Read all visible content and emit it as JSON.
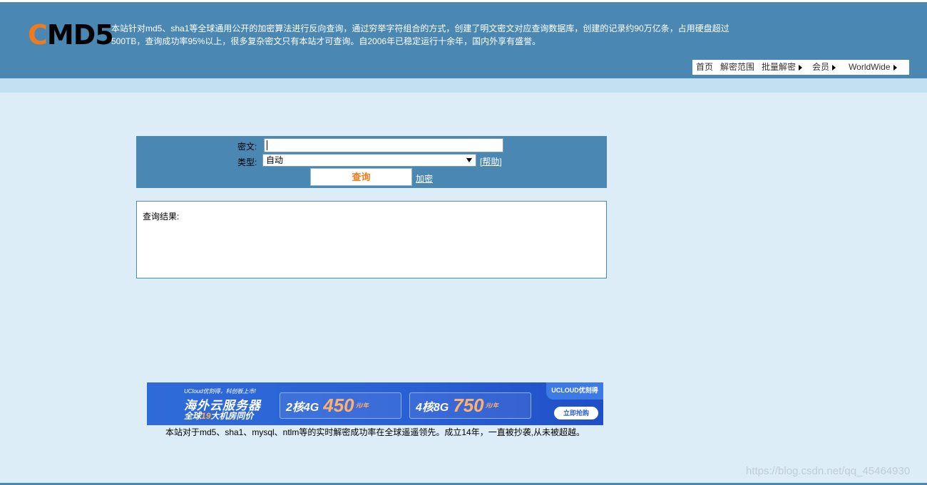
{
  "header": {
    "logo_first": "C",
    "logo_rest": "MD5",
    "intro": "本站针对md5、sha1等全球通用公开的加密算法进行反向查询，通过穷举字符组合的方式，创建了明文密文对应查询数据库，创建的记录约90万亿条，占用硬盘超过500TB，查询成功率95%以上，很多复杂密文只有本站才可查询。自2006年已稳定运行十余年，国内外享有盛誉。"
  },
  "nav": {
    "items": [
      {
        "label": "首页"
      },
      {
        "label": "解密范围"
      },
      {
        "label": "批量解密"
      },
      {
        "label": "会员"
      },
      {
        "label": "WorldWide"
      }
    ]
  },
  "query": {
    "cipher_label": "密文:",
    "cipher_value": "",
    "type_label": "类型:",
    "type_selected": "自动",
    "help_link": "[帮助]",
    "query_button": "查询",
    "encrypt_link": "加密"
  },
  "result": {
    "label": "查询结果:"
  },
  "ad": {
    "small_text": "UCloud优刻得，科创板上市!",
    "title": "海外云服务器",
    "sub_prefix": "全球",
    "sub_highlight": "19",
    "sub_suffix": "大机房同价",
    "card1_spec": "2核4G",
    "card1_price": "450",
    "card1_unit": "元/年",
    "card2_spec": "4核8G",
    "card2_price": "750",
    "card2_unit": "元/年",
    "brand": "UCLOUD优刻得",
    "cta": "立即抢购"
  },
  "footer": {
    "note": "本站对于md5、sha1、mysql、ntlm等的实时解密成功率在全球遥遥领先。成立14年，一直被抄袭,从未被超越。"
  },
  "watermark": "https://blog.csdn.net/qq_45464930",
  "colors": {
    "header_bg": "#4a88b3",
    "page_bg": "#dcedf7",
    "accent_orange": "#f07a1c"
  }
}
